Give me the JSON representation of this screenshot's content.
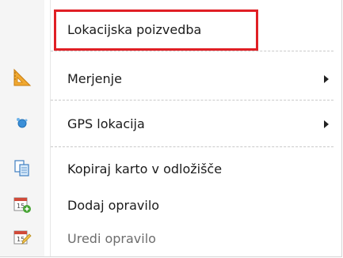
{
  "menu": {
    "items": [
      {
        "label": "Lokacijska poizvedba",
        "icon": "none",
        "has_submenu": false,
        "enabled": true,
        "highlighted": true
      },
      {
        "label": "Merjenje",
        "icon": "ruler-triangle-icon",
        "has_submenu": true,
        "enabled": true
      },
      {
        "label": "GPS lokacija",
        "icon": "gps-dots-icon",
        "has_submenu": true,
        "enabled": true
      },
      {
        "label": "Kopiraj karto v odložišče",
        "icon": "copy-icon",
        "has_submenu": false,
        "enabled": true
      },
      {
        "label": "Dodaj opravilo",
        "icon": "calendar-add-icon",
        "has_submenu": false,
        "enabled": true
      },
      {
        "label": "Uredi opravilo",
        "icon": "calendar-edit-icon",
        "has_submenu": false,
        "enabled": false
      }
    ]
  },
  "colors": {
    "highlight_border": "#e01f25",
    "gutter": "#f5f5f5",
    "disabled_text": "#6d6d6d"
  }
}
